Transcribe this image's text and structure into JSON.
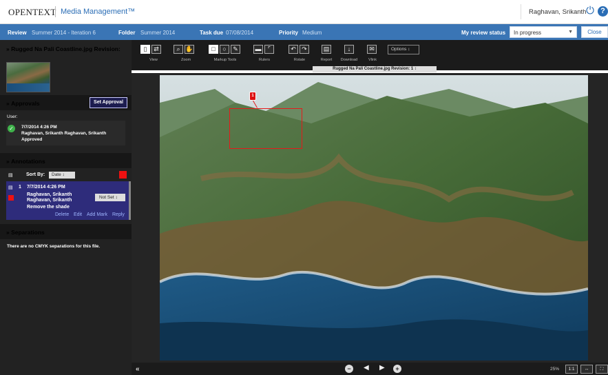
{
  "header": {
    "logo": "OPENTEXT",
    "product": "Media Management™",
    "user": "Raghavan, Srikanth"
  },
  "infobar": {
    "review_label": "Review",
    "review_value": "Summer 2014 - Iteration 6",
    "folder_label": "Folder",
    "folder_value": "Summer 2014",
    "taskdue_label": "Task due",
    "taskdue_value": "07/08/2014",
    "priority_label": "Priority",
    "priority_value": "Medium",
    "status_label": "My review status",
    "status_value": "In progress",
    "close_label": "Close"
  },
  "left": {
    "file_title": "Rugged Na Pali Coastline.jpg Revision:",
    "approvals_title": "Approvals",
    "set_approval": "Set Approval",
    "user_label": "User:",
    "approval_date": "7/7/2014 4:26 PM",
    "approval_names": "Raghavan, Srikanth Raghavan, Srikanth",
    "approval_status": "Approved",
    "annotations_title": "Annotations",
    "sort_label": "Sort By:",
    "sort_value": "Date",
    "annotation": {
      "number": "1",
      "date": "7/7/2014 4:26 PM",
      "author1": "Raghavan, Srikanth",
      "author2": "Raghavan, Srikanth",
      "status": "Not Set",
      "comment": "Remove the shade",
      "actions": [
        "Delete",
        "Edit",
        "Add Mark",
        "Reply"
      ]
    },
    "separations_title": "Separations",
    "separations_text": "There are no CMYK separations for this file."
  },
  "toolbar": {
    "labels": [
      "View",
      "Zoom",
      "Markup Tools",
      "Rulers",
      "Rotate",
      "Report",
      "Download",
      "Vlink"
    ],
    "options": "Options",
    "revision": "Rugged Na Pali Coastline.jpg Revision: 1"
  },
  "viewer": {
    "marker_number": "1"
  },
  "bottom": {
    "zoom": "25%",
    "fit_label": "1:1"
  }
}
